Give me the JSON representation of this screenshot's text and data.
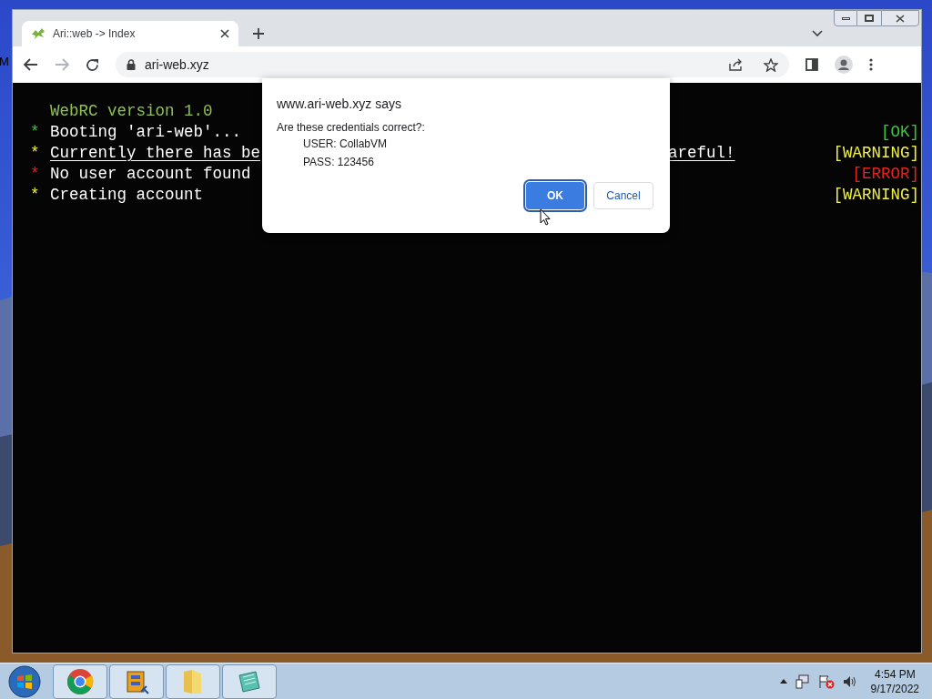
{
  "desktop": {
    "icon_label": "M"
  },
  "browser": {
    "tab": {
      "title": "Ari::web -> Index"
    },
    "address": "ari-web.xyz"
  },
  "terminal": {
    "heading": "WebRC version 1.0",
    "lines": [
      {
        "kind": "ok",
        "bullet": "*",
        "text": "Booting 'ari-web'...",
        "underlined": false,
        "tag": "[OK]"
      },
      {
        "kind": "warning",
        "bullet": "*",
        "text": "Currently there has be",
        "text_tail": "areful!",
        "underlined": true,
        "tag": "[WARNING]"
      },
      {
        "kind": "error",
        "bullet": "*",
        "text": "No user account found",
        "underlined": false,
        "tag": "[ERROR]"
      },
      {
        "kind": "warning",
        "bullet": "*",
        "text": "Creating account",
        "underlined": false,
        "tag": "[WARNING]"
      }
    ]
  },
  "dialog": {
    "title": "www.ari-web.xyz says",
    "message": "Are these credentials correct?:",
    "details": [
      "USER: CollabVM",
      "PASS: 123456"
    ],
    "buttons": [
      {
        "label": "OK",
        "selected": true
      },
      {
        "label": "Cancel",
        "selected": false
      }
    ]
  },
  "taskbar": {
    "time": "4:54 PM",
    "date": "9/17/2022"
  }
}
